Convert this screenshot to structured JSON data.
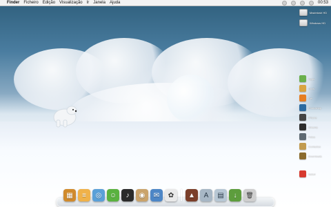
{
  "menubar": {
    "apple_symbol": "",
    "items": [
      "Finder",
      "Ficheiro",
      "Edição",
      "Visualização",
      "Ir",
      "Janela",
      "Ajuda"
    ],
    "status_icons": [
      "icon-1",
      "icon-2",
      "icon-3",
      "icon-4"
    ],
    "clock": "00:53"
  },
  "desktop": {
    "drives": [
      {
        "label": "Macintosh HD",
        "icon": "hard-drive-icon"
      },
      {
        "label": "Windows HD",
        "icon": "hard-drive-icon"
      }
    ],
    "items": [
      {
        "label": "Apps",
        "icon": "app-icon",
        "color": "#6ab04c"
      },
      {
        "label": "Docs",
        "icon": "document-icon",
        "color": "#d9a441"
      },
      {
        "label": "Dw",
        "icon": "folder-icon",
        "color": "#e67e22"
      },
      {
        "label": "Photoshop",
        "icon": "photoshop-icon",
        "color": "#2c6aa0"
      },
      {
        "label": "iPhone",
        "icon": "iphone-icon",
        "color": "#444444"
      },
      {
        "label": "Cinema",
        "icon": "film-icon",
        "color": "#2d2d2d"
      },
      {
        "label": "Fotos",
        "icon": "photos-icon",
        "color": "#5f6a73"
      },
      {
        "label": "Contactos",
        "icon": "contacts-icon",
        "color": "#c29b4f"
      },
      {
        "label": "Downloads",
        "icon": "downloads-icon",
        "color": "#8b6b2d"
      },
      {
        "label": "Safari",
        "icon": "safari-icon",
        "color": "#d73a2f"
      }
    ]
  },
  "dock": {
    "apps": [
      {
        "name": "address-book-icon",
        "color": "#d08a2c",
        "glyph": "▦"
      },
      {
        "name": "notes-icon",
        "color": "#f0b24a",
        "glyph": "≡"
      },
      {
        "name": "safari-icon",
        "color": "#5aa0d8",
        "glyph": "◎"
      },
      {
        "name": "messages-icon",
        "color": "#5ab23f",
        "glyph": "☺"
      },
      {
        "name": "itunes-icon",
        "color": "#2b2b2b",
        "glyph": "♪"
      },
      {
        "name": "owl-icon",
        "color": "#caa36b",
        "glyph": "◉"
      },
      {
        "name": "mail-icon",
        "color": "#4d86c6",
        "glyph": "✉"
      },
      {
        "name": "paw-icon",
        "color": "#e9e9e9",
        "glyph": "✿"
      },
      {
        "name": "stack-icon",
        "color": "#7b3f2a",
        "glyph": "▲"
      },
      {
        "name": "applications-folder-icon",
        "color": "#a7b7c5",
        "glyph": "A"
      },
      {
        "name": "documents-folder-icon",
        "color": "#b7c7d4",
        "glyph": "▤"
      },
      {
        "name": "downloads-folder-icon",
        "color": "#5d9d3d",
        "glyph": "↓"
      },
      {
        "name": "trash-icon",
        "color": "#cfcfcf",
        "glyph": "🗑"
      }
    ]
  }
}
